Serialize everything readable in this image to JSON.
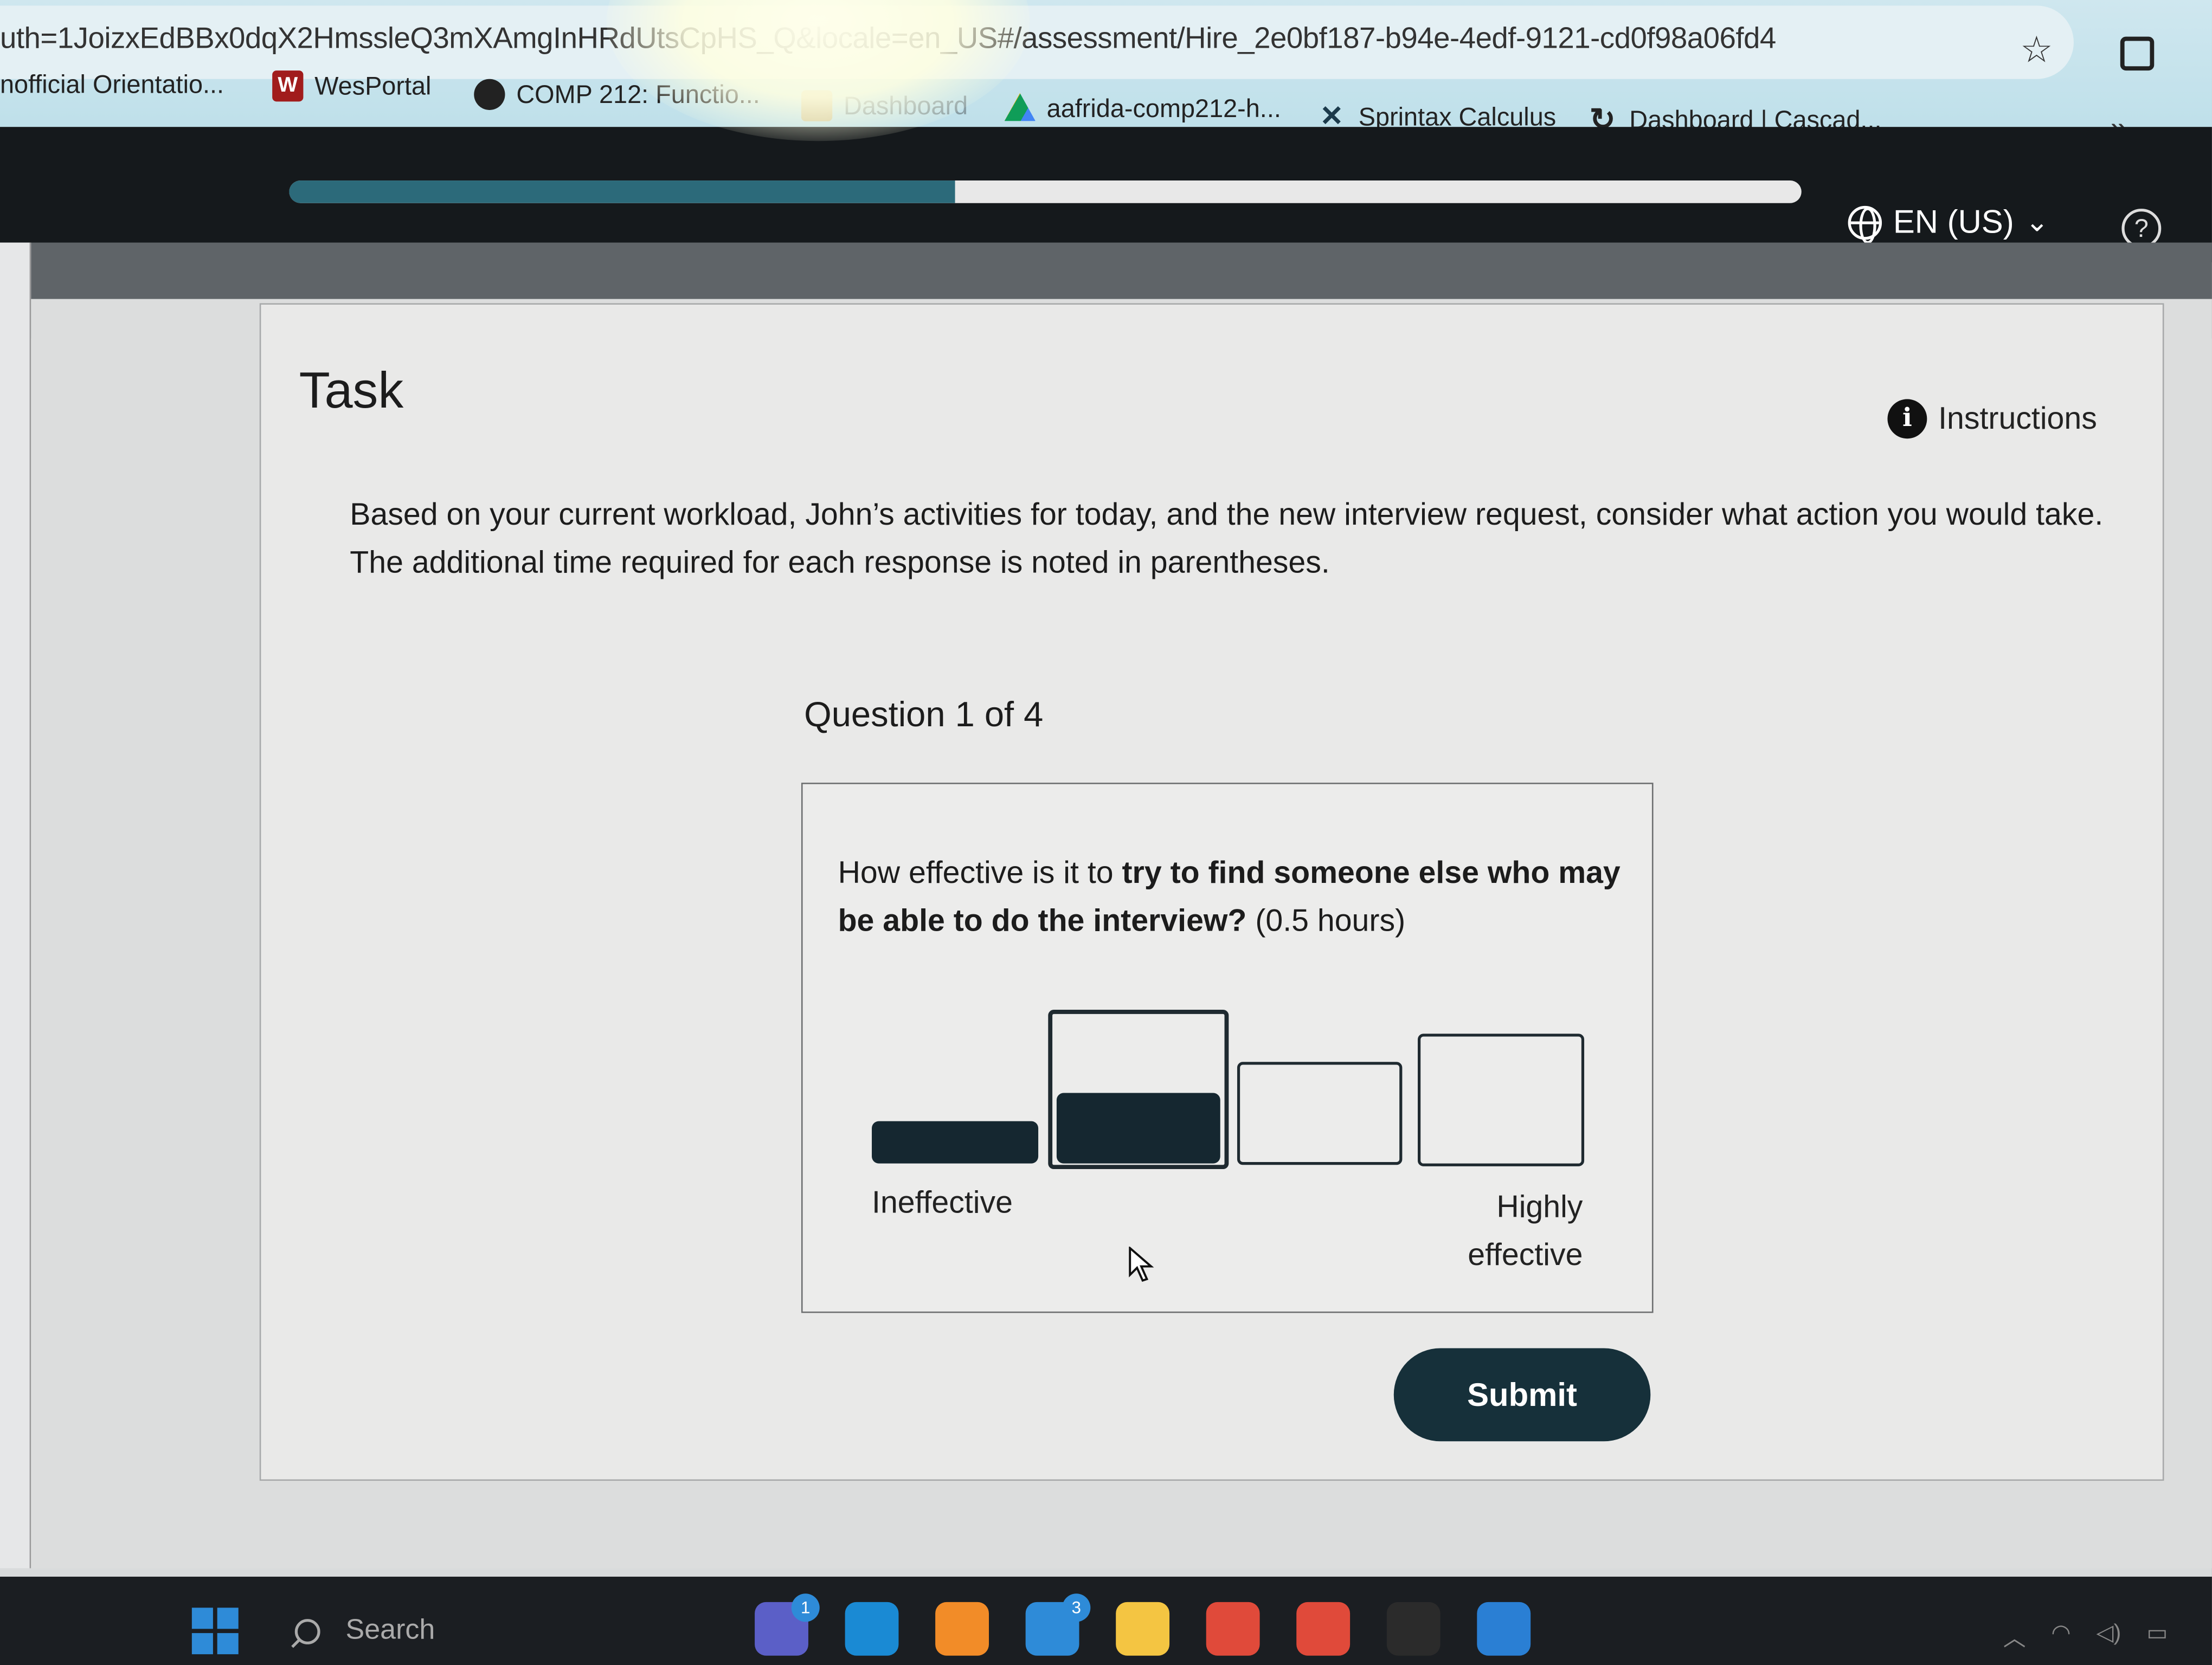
{
  "browser": {
    "url": "uth=1JoizxEdBBx0dqX2HmssleQ3mXAmgInHRdUtsCpHS_Q&locale=en_US#/assessment/Hire_2e0bf187-b94e-4edf-9121-cd0f98a06fd4",
    "bookmarks": [
      {
        "label": "nofficial Orientatio...",
        "icon": "page-icon"
      },
      {
        "label": "WesPortal",
        "icon": "w-icon",
        "icon_text": "W"
      },
      {
        "label": "COMP 212: Functio...",
        "icon": "globe-icon"
      },
      {
        "label": "Dashboard",
        "icon": "moodle-icon"
      },
      {
        "label": "aafrida-comp212-h...",
        "icon": "drive-icon"
      },
      {
        "label": "Sprintax Calculus",
        "icon": "sprintax-icon"
      },
      {
        "label": "Dashboard | Cascad...",
        "icon": "canvas-icon"
      }
    ],
    "overflow_label": "»"
  },
  "header": {
    "progress_fraction": 0.44,
    "language": "EN (US)",
    "help_label": "?"
  },
  "task": {
    "title": "Task",
    "instructions_label": "Instructions",
    "prompt": "Based on your current workload, John’s activities for today, and the new interview request, consider what action you would take. The additional time required for each response is noted in parentheses.",
    "question_counter": "Question 1 of 4",
    "question": {
      "prefix": "How effective is it to ",
      "bold": "try to find someone else who may be able to do the interview?",
      "suffix": " (0.5 hours)"
    },
    "scale": {
      "options": 4,
      "selected": 2,
      "low_label": "Ineffective",
      "high_label": "Highly effective"
    },
    "submit_label": "Submit"
  },
  "taskbar": {
    "search_placeholder": "Search",
    "apps": [
      {
        "name": "teams-icon",
        "color": "#5b5fc7",
        "badge": "1"
      },
      {
        "name": "edge-icon",
        "color": "#1a8ad4"
      },
      {
        "name": "sublime-icon",
        "color": "#f28c28"
      },
      {
        "name": "mail-icon",
        "color": "#2e8bd8",
        "badge": "3"
      },
      {
        "name": "file-explorer-icon",
        "color": "#f4c542"
      },
      {
        "name": "chrome-icon",
        "color": "#e04a3a"
      },
      {
        "name": "chrome-profile-icon",
        "color": "#e04a3a"
      },
      {
        "name": "terminal-icon",
        "color": "#2b2b2b"
      },
      {
        "name": "vscode-icon",
        "color": "#2a7fd4"
      }
    ]
  },
  "colors": {
    "accent_dark": "#16303a",
    "progress_fill": "#2c6a7a"
  }
}
